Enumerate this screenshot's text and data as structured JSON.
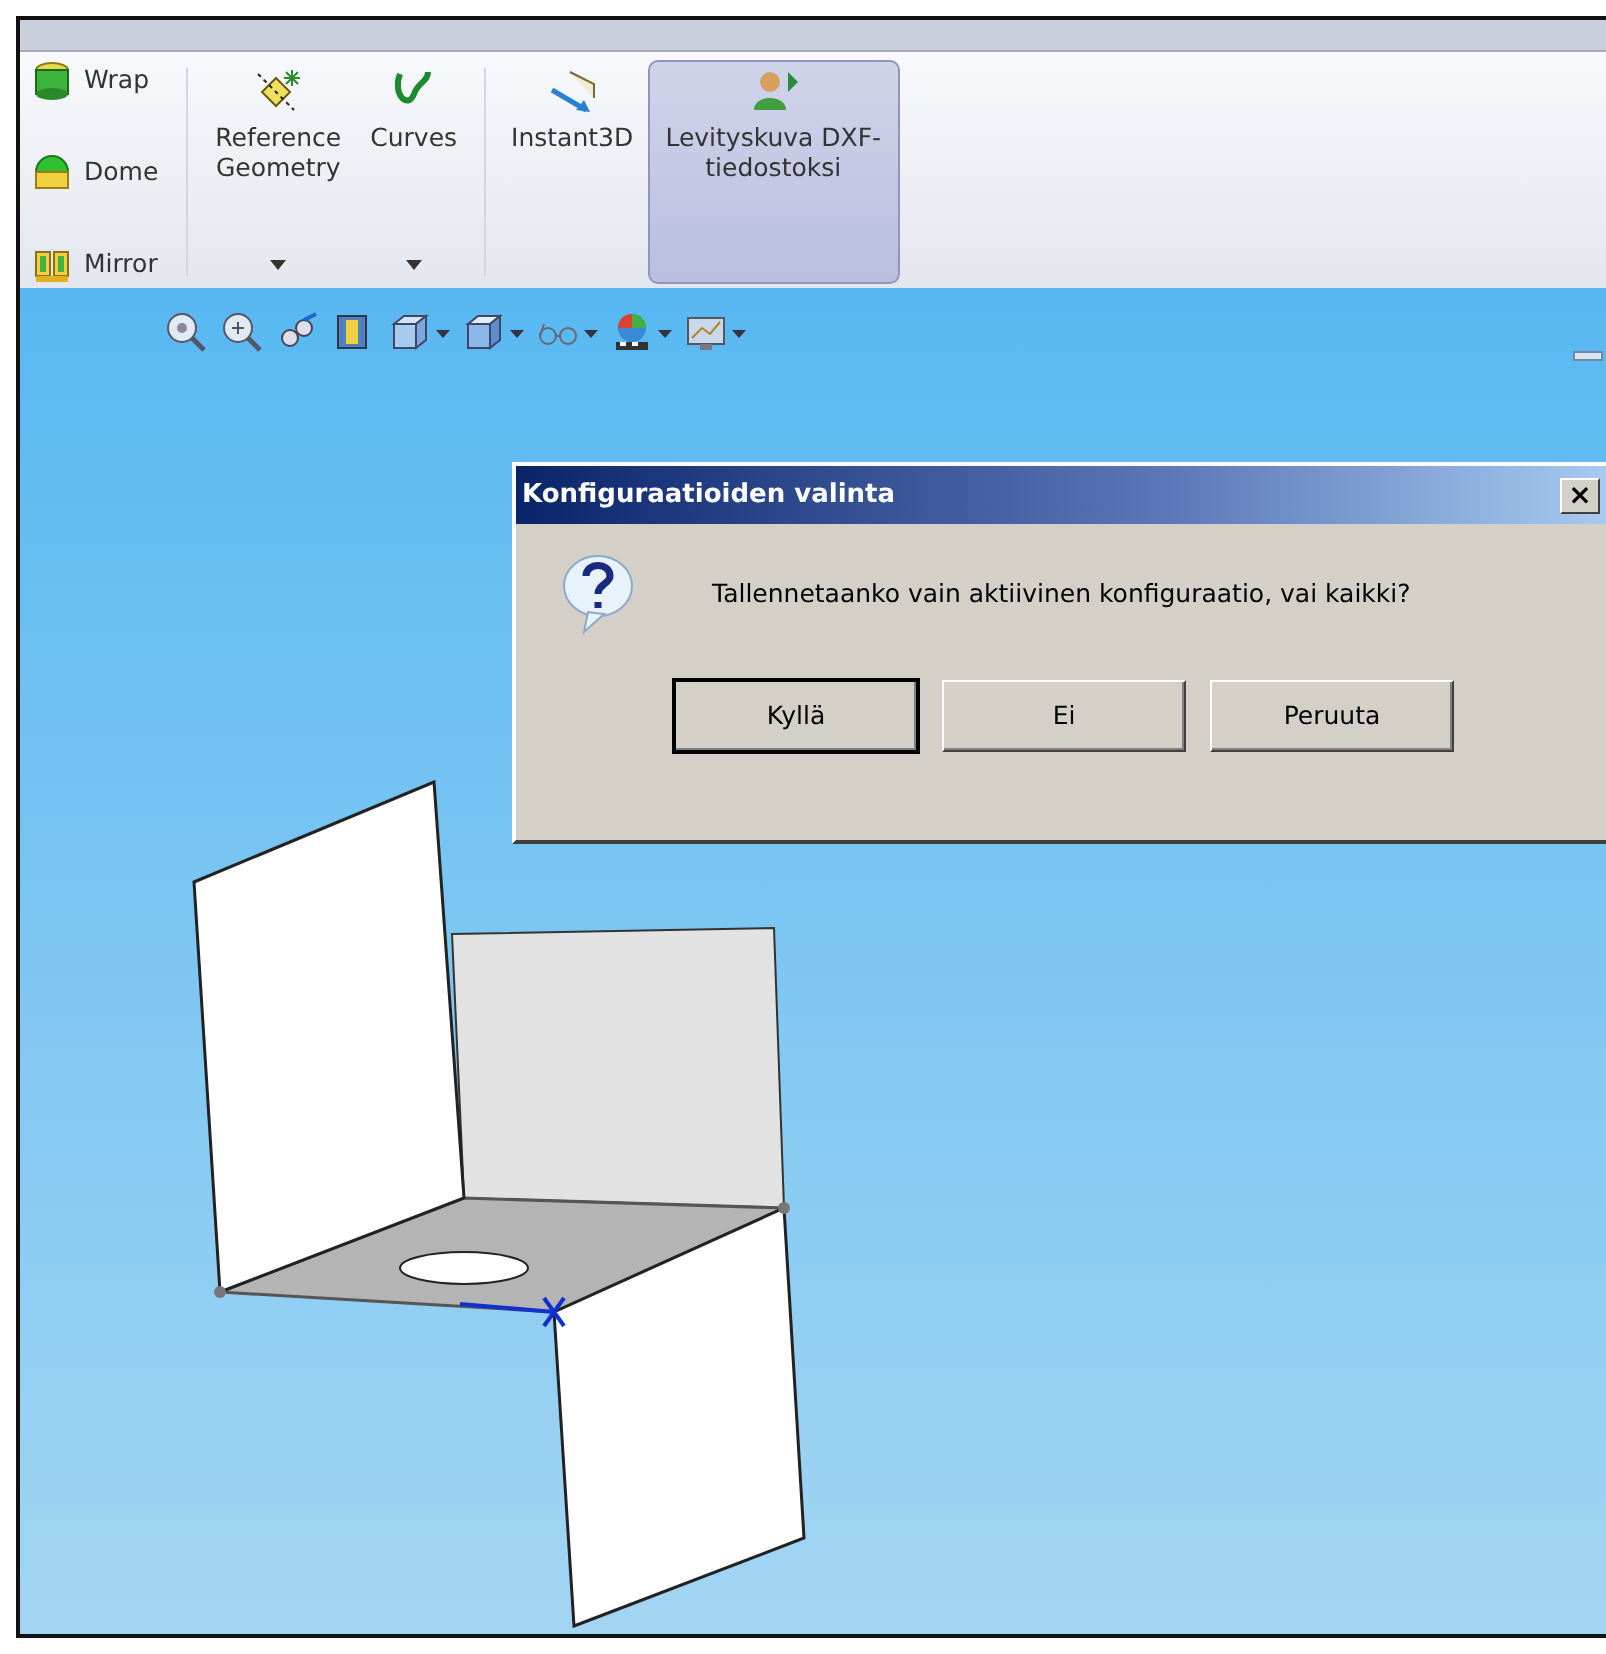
{
  "ribbon": {
    "small_items": [
      {
        "kind": "wrap",
        "label": "Wrap"
      },
      {
        "kind": "dome",
        "label": "Dome"
      },
      {
        "kind": "mirror",
        "label": "Mirror"
      }
    ],
    "groups": [
      [
        {
          "kind": "reference",
          "label": "Reference Geometry",
          "dropdown": true,
          "selected": false
        },
        {
          "kind": "curves",
          "label": "Curves",
          "dropdown": true,
          "selected": false
        }
      ],
      [
        {
          "kind": "instant3d",
          "label": "Instant3D",
          "dropdown": false,
          "selected": false
        },
        {
          "kind": "flatten",
          "label": "Levityskuva DXF-tiedostoksi",
          "dropdown": false,
          "selected": true
        }
      ]
    ]
  },
  "view_toolbar": [
    {
      "kind": "zoom-fit",
      "dropdown": false
    },
    {
      "kind": "zoom-area",
      "dropdown": false
    },
    {
      "kind": "previous",
      "dropdown": false
    },
    {
      "kind": "section",
      "dropdown": false
    },
    {
      "kind": "orientation",
      "dropdown": true
    },
    {
      "kind": "display",
      "dropdown": true
    },
    {
      "kind": "hide-show",
      "dropdown": true
    },
    {
      "kind": "appearance",
      "dropdown": true
    },
    {
      "kind": "scene",
      "dropdown": true
    }
  ],
  "dialog": {
    "title": "Konfiguraatioiden valinta",
    "close": "×",
    "message": "Tallennetaanko vain aktiivinen konfiguraatio, vai kaikki?",
    "buttons": [
      {
        "label": "Kyllä",
        "default": true
      },
      {
        "label": "Ei",
        "default": false
      },
      {
        "label": "Peruuta",
        "default": false
      }
    ]
  }
}
